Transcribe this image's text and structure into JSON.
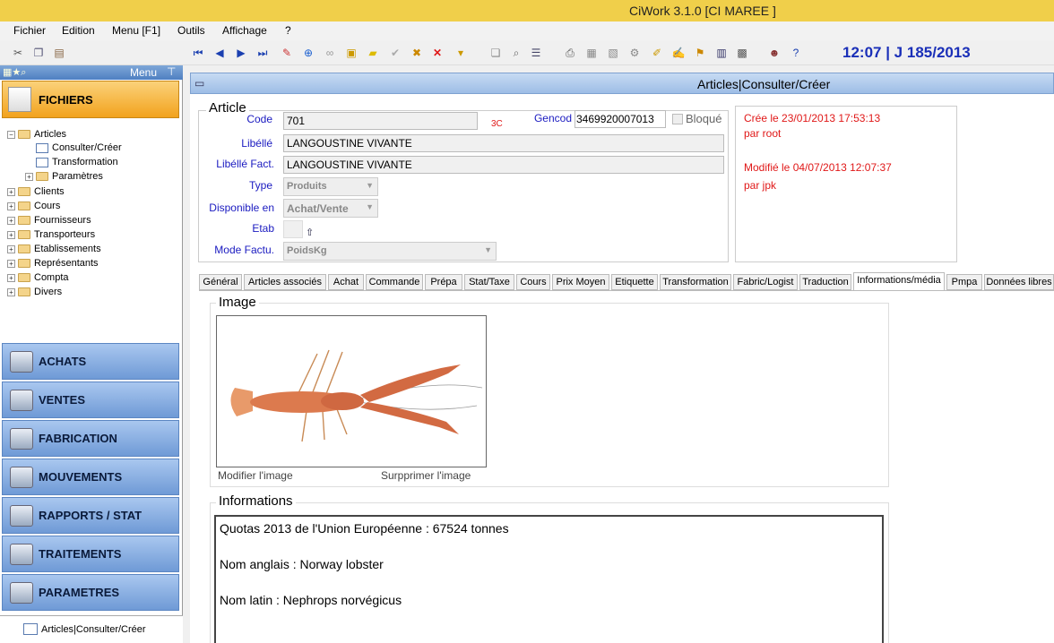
{
  "window": {
    "title": "CiWork 3.1.0 [CI MAREE ]"
  },
  "menu": [
    "Fichier",
    "Edition",
    "Menu [F1]",
    "Outils",
    "Affichage",
    "?"
  ],
  "clock": "12:07 | J 185/2013",
  "left_panel": {
    "header": "Menu",
    "section": "FICHIERS",
    "tree": [
      {
        "label": "Articles",
        "kind": "folder",
        "level": 0,
        "expander": "−"
      },
      {
        "label": "Consulter/Créer",
        "kind": "doc",
        "level": 1
      },
      {
        "label": "Transformation",
        "kind": "doc",
        "level": 1
      },
      {
        "label": "Paramètres",
        "kind": "folder",
        "level": 1,
        "expander": "+"
      },
      {
        "label": "Clients",
        "kind": "folder",
        "level": 0,
        "expander": "+"
      },
      {
        "label": "Cours",
        "kind": "folder",
        "level": 0,
        "expander": "+"
      },
      {
        "label": "Fournisseurs",
        "kind": "folder",
        "level": 0,
        "expander": "+"
      },
      {
        "label": "Transporteurs",
        "kind": "folder",
        "level": 0,
        "expander": "+"
      },
      {
        "label": "Etablissements",
        "kind": "folder",
        "level": 0,
        "expander": "+"
      },
      {
        "label": "Représentants",
        "kind": "folder",
        "level": 0,
        "expander": "+"
      },
      {
        "label": "Compta",
        "kind": "folder",
        "level": 0,
        "expander": "+"
      },
      {
        "label": "Divers",
        "kind": "folder",
        "level": 0,
        "expander": "+"
      }
    ],
    "nav_buttons": [
      "ACHATS",
      "VENTES",
      "FABRICATION",
      "MOUVEMENTS",
      "RAPPORTS / STAT",
      "TRAITEMENTS",
      "PARAMETRES"
    ],
    "bottom_item": "Articles|Consulter/Créer"
  },
  "main": {
    "header": "Articles|Consulter/Créer",
    "article_group": "Article",
    "fields": {
      "code_label": "Code",
      "code_value": "701",
      "code_tag": "3C",
      "gencod_label": "Gencod",
      "gencod_value": "3469920007013",
      "bloque_label": "Bloqué",
      "libelle_label": "Libéllé",
      "libelle_value": "LANGOUSTINE VIVANTE",
      "libelle_fact_label": "Libéllé Fact.",
      "libelle_fact_value": "LANGOUSTINE VIVANTE",
      "type_label": "Type",
      "type_value": "Produits",
      "dispo_label": "Disponible en",
      "dispo_value": "Achat/Vente",
      "etab_label": "Etab",
      "mode_label": "Mode Factu.",
      "mode_value": "PoidsKg"
    },
    "audit": {
      "created": "Crée le 23/01/2013 17:53:13",
      "created_by": "par root",
      "modified": "Modifié le 04/07/2013 12:07:37",
      "modified_by": "par jpk"
    },
    "tabs": [
      "Général",
      "Articles associés",
      "Achat",
      "Commande",
      "Prépa",
      "Stat/Taxe",
      "Cours",
      "Prix Moyen",
      "Etiquette",
      "Transformation",
      "Fabric/Logist",
      "Traduction",
      "Informations/média",
      "Pmpa",
      "Données libres"
    ],
    "active_tab": "Informations/média",
    "image_group": "Image",
    "modify_image": "Modifier l'image",
    "delete_image": "Surpprimer l'image",
    "info_group": "Informations",
    "info_lines": [
      "Quotas 2013 de l'Union Européenne : 67524 tonnes",
      "Nom anglais : Norway lobster",
      "Nom latin :  Nephrops norvégicus"
    ]
  },
  "colors": {
    "titlebar": "#f0cf4a",
    "accent": "#f2a21d",
    "label_blue": "#1a1ac0",
    "audit_red": "#e01818",
    "clock_blue": "#1a2fb8"
  }
}
